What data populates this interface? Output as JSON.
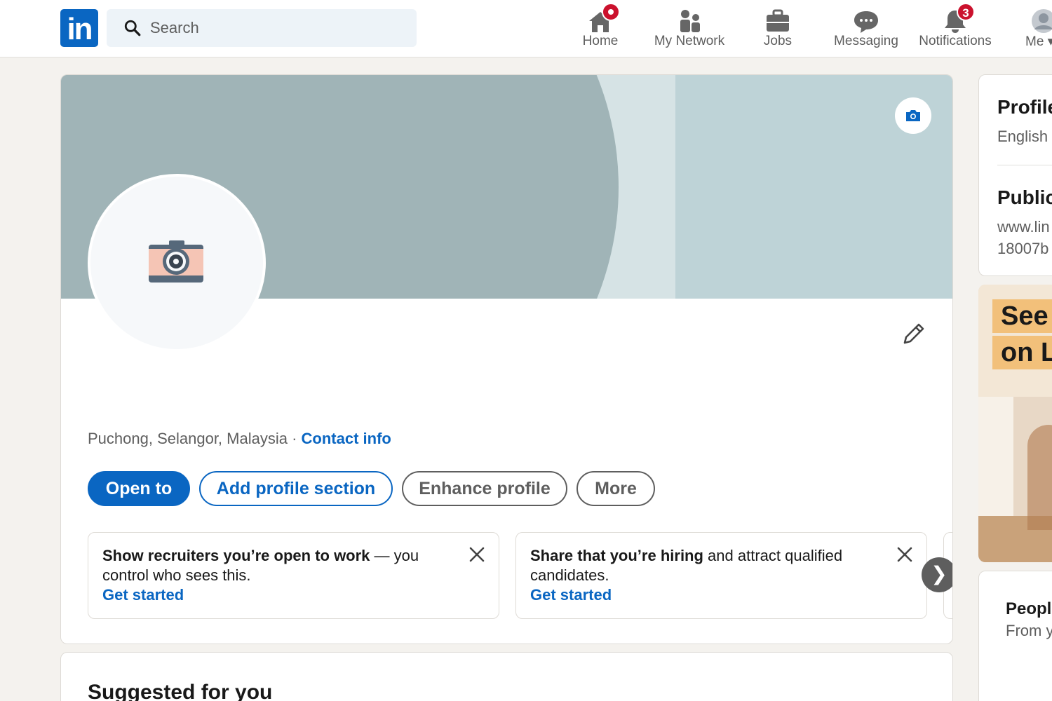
{
  "nav": {
    "logo_text": "in",
    "search_placeholder": "Search",
    "items": [
      {
        "label": "Home",
        "icon": "home-icon"
      },
      {
        "label": "My Network",
        "icon": "network-icon"
      },
      {
        "label": "Jobs",
        "icon": "briefcase-icon"
      },
      {
        "label": "Messaging",
        "icon": "messaging-icon"
      },
      {
        "label": "Notifications",
        "icon": "bell-icon",
        "badge": "3"
      },
      {
        "label": "Me",
        "icon": "avatar-icon"
      }
    ]
  },
  "profile": {
    "location": "Puchong, Selangor, Malaysia",
    "separator": " · ",
    "contact_info": "Contact info",
    "buttons": {
      "open_to": "Open to",
      "add_section": "Add profile section",
      "enhance": "Enhance profile",
      "more": "More"
    },
    "suggestions": [
      {
        "bold": "Show recruiters you’re open to work",
        "rest": " — you control who sees this.",
        "link": "Get started"
      },
      {
        "bold": "Share that you’re hiring",
        "rest": " and attract qualified candidates.",
        "link": "Get started"
      }
    ],
    "carousel_next": "❯"
  },
  "suggested": {
    "title": "Suggested for you"
  },
  "sidebar": {
    "profile_language_title": "Profile",
    "profile_language_value": "English",
    "public_title": "Public",
    "public_url_line1": "www.lin",
    "public_url_line2": "18007b",
    "ad_line1": "See",
    "ad_line2": "on Li",
    "people_title": "Peopl",
    "people_sub": "From y"
  },
  "colors": {
    "brand": "#0a66c2",
    "badge": "#cb112d",
    "banner": "#a0b4b7"
  }
}
